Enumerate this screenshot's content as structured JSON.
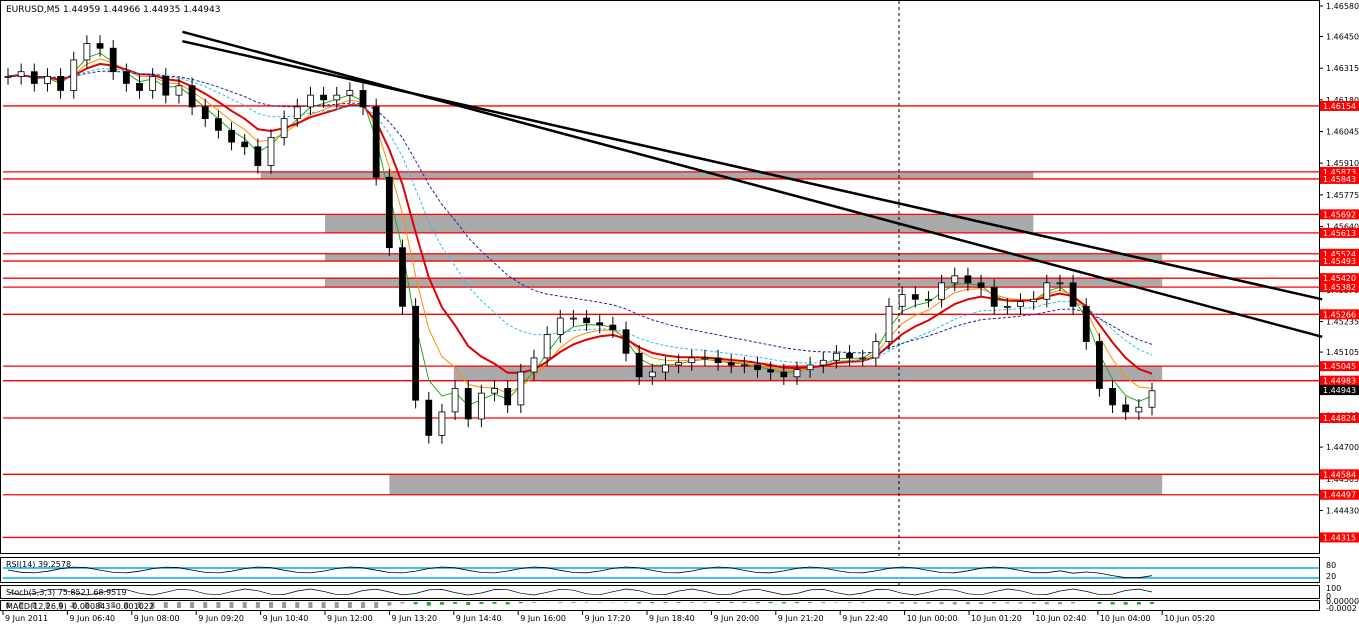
{
  "chart_data": {
    "type": "candlestick",
    "title": "EURUSD,M5  1.44959 1.44966 1.44935 1.44943",
    "symbol": "EURUSD",
    "timeframe": "M5",
    "ylim": [
      1.4427,
      1.4658
    ],
    "x_ticks": [
      "9 Jun 2011",
      "9 Jun 06:40",
      "9 Jun 08:00",
      "9 Jun 09:20",
      "9 Jun 10:40",
      "9 Jun 12:00",
      "9 Jun 13:20",
      "9 Jun 14:40",
      "9 Jun 16:00",
      "9 Jun 17:20",
      "9 Jun 18:40",
      "9 Jun 20:00",
      "9 Jun 21:20",
      "9 Jun 22:40",
      "10 Jun 00:00",
      "10 Jun 01:20",
      "10 Jun 02:40",
      "10 Jun 04:00",
      "10 Jun 05:20"
    ],
    "y_ticks": [
      "1.46580",
      "1.46450",
      "1.46315",
      "1.46180",
      "1.46045",
      "1.45910",
      "1.45775",
      "1.45640",
      "1.45505",
      "1.45370",
      "1.45235",
      "1.45105",
      "1.44970",
      "1.44835",
      "1.44700",
      "1.44565",
      "1.44430"
    ],
    "levels": [
      {
        "label": "1.46154",
        "value": 1.46154
      },
      {
        "label": "1.45873",
        "value": 1.45873
      },
      {
        "label": "1.45843",
        "value": 1.45843
      },
      {
        "label": "1.45692",
        "value": 1.45692
      },
      {
        "label": "1.45613",
        "value": 1.45613
      },
      {
        "label": "1.45524",
        "value": 1.45524
      },
      {
        "label": "1.45493",
        "value": 1.45493
      },
      {
        "label": "1.45420",
        "value": 1.4542
      },
      {
        "label": "1.45382",
        "value": 1.45382
      },
      {
        "label": "1.45266",
        "value": 1.45266
      },
      {
        "label": "1.45045",
        "value": 1.45045
      },
      {
        "label": "1.44983",
        "value": 1.44983
      },
      {
        "label": "1.44824",
        "value": 1.44824
      },
      {
        "label": "1.44584",
        "value": 1.44584
      },
      {
        "label": "1.44497",
        "value": 1.44497
      },
      {
        "label": "1.44315",
        "value": 1.44315
      }
    ],
    "zones": [
      {
        "from": 1.45873,
        "to": 1.45843,
        "x_from": "9 Jun 10:40",
        "x_to": "10 Jun 02:40"
      },
      {
        "from": 1.45692,
        "to": 1.45613,
        "x_from": "9 Jun 12:00",
        "x_to": "10 Jun 02:40"
      },
      {
        "from": 1.45524,
        "to": 1.45493,
        "x_from": "9 Jun 12:00",
        "x_to": "10 Jun 05:20"
      },
      {
        "from": 1.4542,
        "to": 1.45382,
        "x_from": "9 Jun 12:00",
        "x_to": "10 Jun 05:20"
      },
      {
        "from": 1.45045,
        "to": 1.44983,
        "x_from": "9 Jun 14:40",
        "x_to": "10 Jun 05:20"
      },
      {
        "from": 1.44584,
        "to": 1.44497,
        "x_from": "9 Jun 13:20",
        "x_to": "10 Jun 05:20"
      }
    ],
    "trendlines": [
      {
        "x1": "9 Jun 06:40",
        "y1": 1.4647,
        "x2": "10 Jun 05:20",
        "y2": 1.4517
      },
      {
        "x1": "9 Jun 06:40",
        "y1": 1.4643,
        "x2": "10 Jun 05:20",
        "y2": 1.4533
      }
    ],
    "current_price": {
      "label": "1.44943",
      "value": 1.44943
    },
    "close_series": [
      1.4628,
      1.463,
      1.4625,
      1.4628,
      1.4622,
      1.4635,
      1.4642,
      1.464,
      1.463,
      1.4625,
      1.4622,
      1.4628,
      1.462,
      1.4624,
      1.4615,
      1.461,
      1.4605,
      1.46,
      1.4598,
      1.459,
      1.4602,
      1.461,
      1.4615,
      1.462,
      1.4618,
      1.462,
      1.4622,
      1.4615,
      1.4585,
      1.4555,
      1.453,
      1.449,
      1.4475,
      1.4485,
      1.4495,
      1.4482,
      1.4493,
      1.4495,
      1.4488,
      1.4502,
      1.4508,
      1.4518,
      1.4525,
      1.4525,
      1.4523,
      1.4522,
      1.452,
      1.451,
      1.45,
      1.4502,
      1.4505,
      1.4506,
      1.4508,
      1.4508,
      1.4506,
      1.4505,
      1.4505,
      1.4503,
      1.4502,
      1.45,
      1.4503,
      1.4505,
      1.4507,
      1.451,
      1.4508,
      1.4508,
      1.4515,
      1.453,
      1.4535,
      1.4533,
      1.4533,
      1.454,
      1.4543,
      1.454,
      1.4538,
      1.453,
      1.453,
      1.4532,
      1.4533,
      1.454,
      1.454,
      1.453,
      1.4515,
      1.4495,
      1.4488,
      1.4485,
      1.4487,
      1.4494
    ],
    "indicators": {
      "rsi_label": "RSI(14) 39.2578",
      "rsi_levels": [
        "80",
        "20"
      ],
      "stoch_label": "Stoch(5,3,3) 75.8521 68.9519",
      "stoch_levels": [
        "100",
        "0"
      ],
      "macd_label": "MACD(12,26,9) -0.000843 -0.001022",
      "macd_scale": [
        "0.00000",
        "-0.0002"
      ]
    },
    "colors": {
      "level_line": "#ff0000",
      "level_label_bg": "#ff0000",
      "zone_fill": "#a9a9a9",
      "trendline": "#000000",
      "ma_slow": "#e00000",
      "ma_orange": "#ff8c00",
      "ma_green": "#22aa22",
      "ma_cyan": "#33bbee",
      "ma_navy": "#2222aa",
      "candle_up": "#ffffff",
      "candle_down": "#000000",
      "rsi_line": "#000000",
      "rsi_level": "#00aaff"
    }
  }
}
